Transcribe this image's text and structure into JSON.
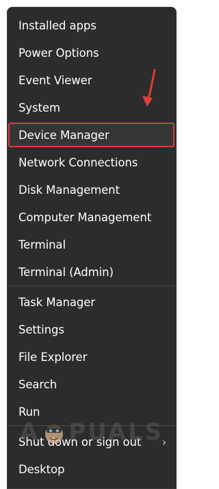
{
  "menu": {
    "items": [
      {
        "label": "Installed apps"
      },
      {
        "label": "Power Options"
      },
      {
        "label": "Event Viewer"
      },
      {
        "label": "System"
      },
      {
        "label": "Device Manager"
      },
      {
        "label": "Network Connections"
      },
      {
        "label": "Disk Management"
      },
      {
        "label": "Computer Management"
      },
      {
        "label": "Terminal"
      },
      {
        "label": "Terminal (Admin)"
      },
      {
        "label": "Task Manager"
      },
      {
        "label": "Settings"
      },
      {
        "label": "File Explorer"
      },
      {
        "label": "Search"
      },
      {
        "label": "Run"
      },
      {
        "label": "Shut down or sign out"
      },
      {
        "label": "Desktop"
      }
    ],
    "submenu_indicator": "›",
    "highlighted_item": "Device Manager"
  },
  "annotation": {
    "arrow_color": "#e03c3c",
    "highlight_color": "#e03c3c"
  },
  "watermark": {
    "text_left": "A",
    "text_right": "PUALS"
  },
  "colors": {
    "menu_background": "#2c2c2c",
    "text": "#ffffff",
    "separator": "#4a4a4a"
  }
}
